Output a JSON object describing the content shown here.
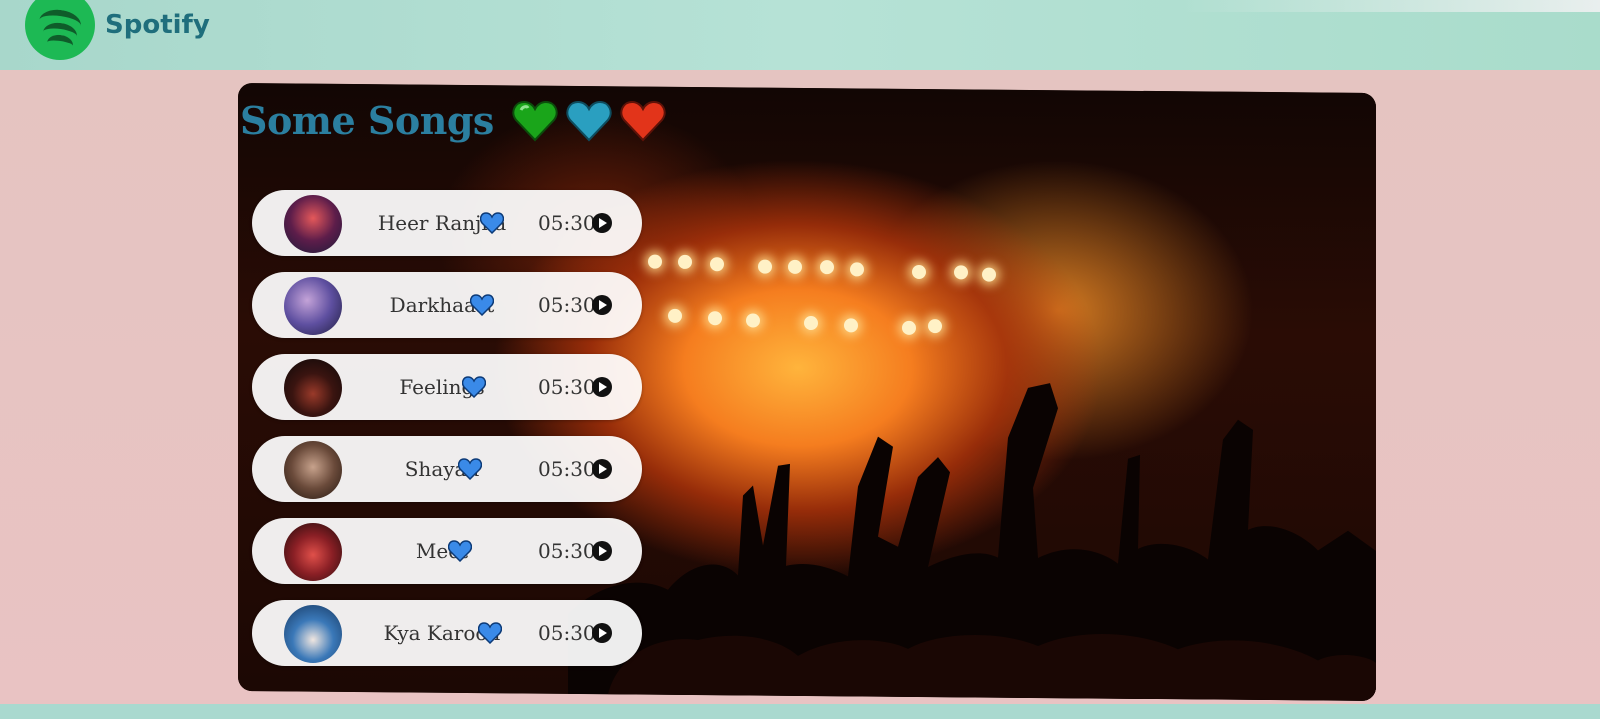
{
  "navbar": {
    "brand": "Spotify",
    "logo_icon": "spotify-logo-icon",
    "logo_color": "#1db954"
  },
  "main": {
    "title": "Some Songs",
    "title_hearts": [
      {
        "icon": "heart-icon",
        "color": "#1aa51a"
      },
      {
        "icon": "heart-icon",
        "color": "#2a9fc0"
      },
      {
        "icon": "heart-icon",
        "color": "#e2341a"
      }
    ],
    "songs": [
      {
        "name": "Heer Ranjha",
        "duration": "05:30",
        "heart_color": "#3a8ae8"
      },
      {
        "name": "Darkhaast",
        "duration": "05:30",
        "heart_color": "#3a8ae8"
      },
      {
        "name": "Feelings",
        "duration": "05:30",
        "heart_color": "#3a8ae8"
      },
      {
        "name": "Shayad",
        "duration": "05:30",
        "heart_color": "#3a8ae8"
      },
      {
        "name": "Meet",
        "duration": "05:30",
        "heart_color": "#3a8ae8"
      },
      {
        "name": "Kya Karoon",
        "duration": "05:30",
        "heart_color": "#3a8ae8"
      }
    ]
  },
  "colors": {
    "navbar": "#b3dfd3",
    "page_background": "#e6c3c2",
    "title": "#2b7fa0"
  }
}
